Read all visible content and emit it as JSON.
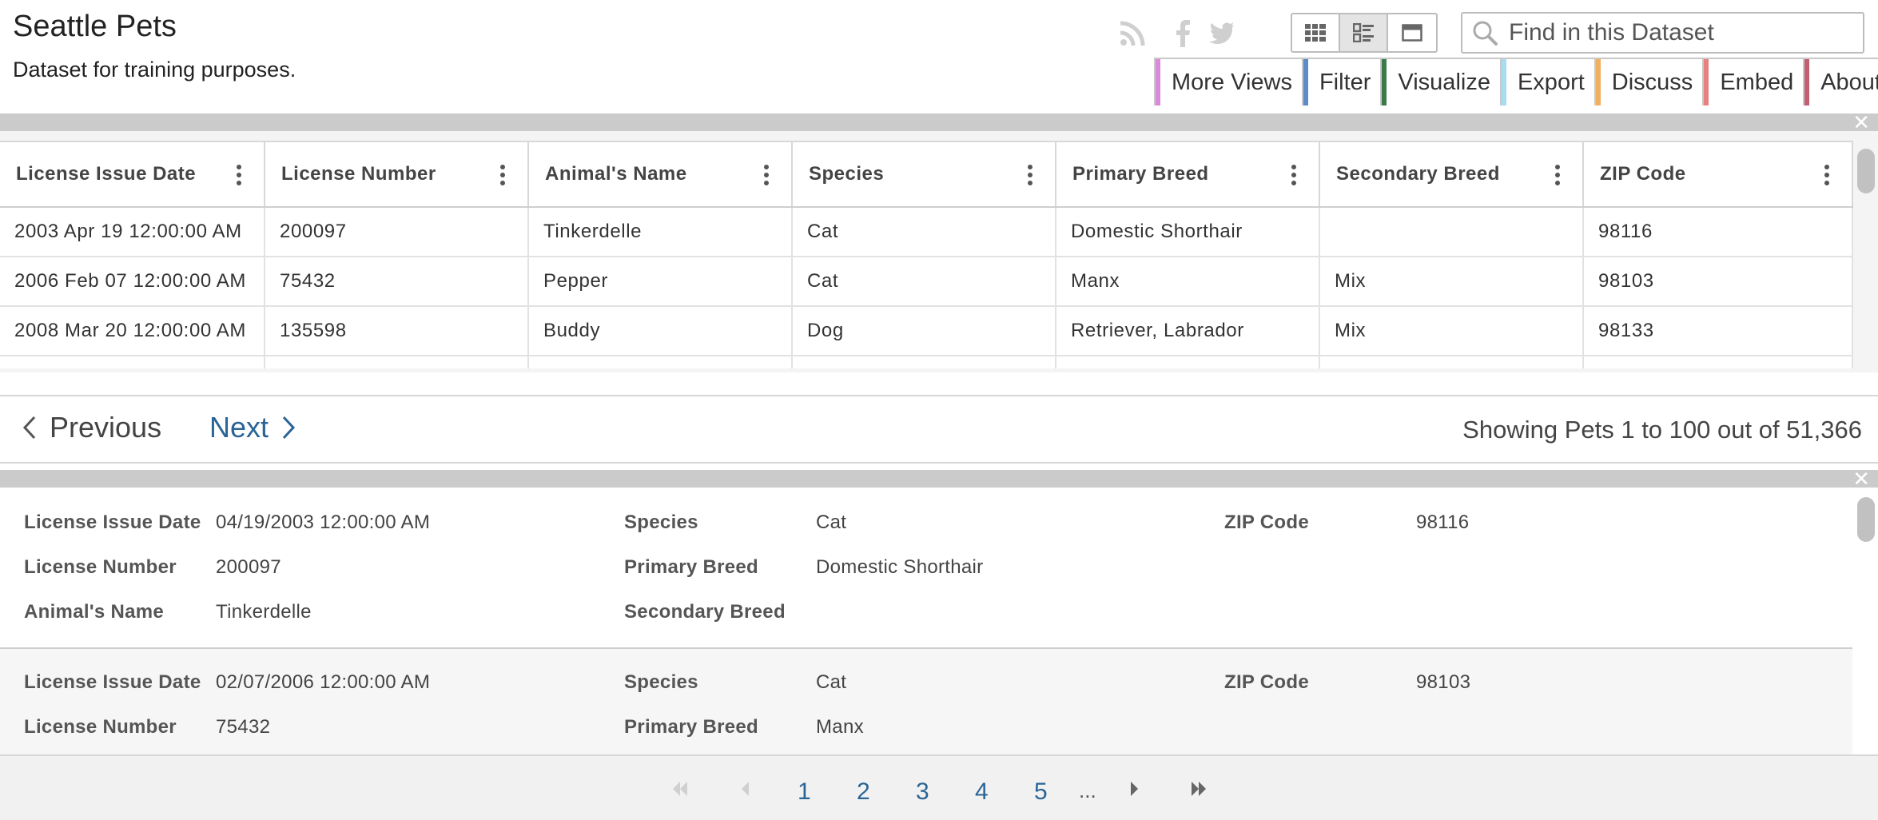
{
  "header": {
    "title": "Seattle Pets",
    "description": "Dataset for training purposes."
  },
  "social": [
    "rss-icon",
    "facebook-icon",
    "twitter-icon"
  ],
  "view_toggle": [
    {
      "name": "grid-view-icon",
      "active": false
    },
    {
      "name": "row-view-icon",
      "active": true
    },
    {
      "name": "page-view-icon",
      "active": false
    }
  ],
  "search": {
    "placeholder": "Find in this Dataset",
    "value": ""
  },
  "menu": [
    {
      "label": "More Views",
      "color": "#d98ad9"
    },
    {
      "label": "Filter",
      "color": "#5a8cc8"
    },
    {
      "label": "Visualize",
      "color": "#3d7a4a"
    },
    {
      "label": "Export",
      "color": "#a8dcf0"
    },
    {
      "label": "Discuss",
      "color": "#f0b060"
    },
    {
      "label": "Embed",
      "color": "#e88080"
    },
    {
      "label": "About",
      "color": "#c06070"
    }
  ],
  "grid": {
    "columns": [
      "License Issue Date",
      "License Number",
      "Animal's Name",
      "Species",
      "Primary Breed",
      "Secondary Breed",
      "ZIP Code"
    ],
    "rows": [
      [
        "2003 Apr 19 12:00:00 AM",
        "200097",
        "Tinkerdelle",
        "Cat",
        "Domestic Shorthair",
        "",
        "98116"
      ],
      [
        "2006 Feb 07 12:00:00 AM",
        "75432",
        "Pepper",
        "Cat",
        "Manx",
        "Mix",
        "98103"
      ],
      [
        "2008 Mar 20 12:00:00 AM",
        "135598",
        "Buddy",
        "Dog",
        "Retriever, Labrador",
        "Mix",
        "98133"
      ]
    ]
  },
  "pager": {
    "previous": "Previous",
    "next": "Next",
    "showing": "Showing Pets 1 to 100 out of 51,366"
  },
  "records": [
    {
      "license_issue_date_label": "License Issue Date",
      "license_issue_date": "04/19/2003 12:00:00 AM",
      "license_number_label": "License Number",
      "license_number": "200097",
      "animal_name_label": "Animal's Name",
      "animal_name": "Tinkerdelle",
      "species_label": "Species",
      "species": "Cat",
      "primary_breed_label": "Primary Breed",
      "primary_breed": "Domestic Shorthair",
      "secondary_breed_label": "Secondary Breed",
      "secondary_breed": "",
      "zip_label": "ZIP Code",
      "zip": "98116"
    },
    {
      "license_issue_date_label": "License Issue Date",
      "license_issue_date": "02/07/2006 12:00:00 AM",
      "license_number_label": "License Number",
      "license_number": "75432",
      "species_label": "Species",
      "species": "Cat",
      "primary_breed_label": "Primary Breed",
      "primary_breed": "Manx",
      "zip_label": "ZIP Code",
      "zip": "98103"
    }
  ],
  "bottom_pager": {
    "pages": [
      "1",
      "2",
      "3",
      "4",
      "5"
    ],
    "ellipsis": "..."
  },
  "colors": {
    "link": "#2a6496",
    "separator": "#cbcbcb"
  }
}
